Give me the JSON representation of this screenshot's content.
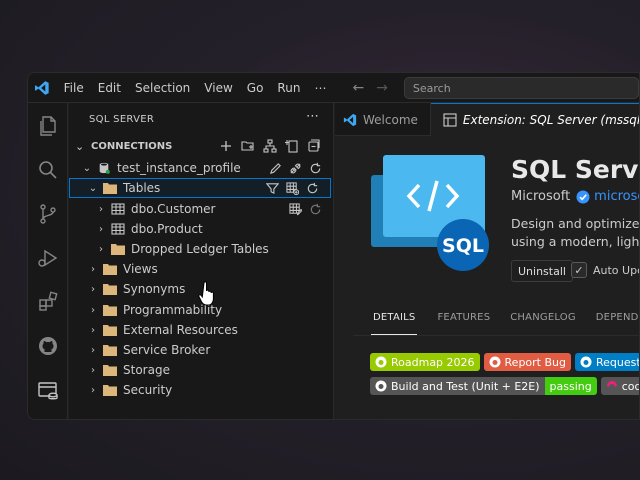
{
  "menu": [
    "File",
    "Edit",
    "Selection",
    "View",
    "Go",
    "Run",
    "⋯"
  ],
  "search": {
    "placeholder": "Search"
  },
  "activity_icons": [
    "explorer-icon",
    "search-icon",
    "source-control-icon",
    "run-debug-icon",
    "extensions-icon",
    "github-icon",
    "sql-server-icon"
  ],
  "sidebar": {
    "title": "SQL SERVER",
    "more": "⋯",
    "section": "CONNECTIONS",
    "tree": [
      {
        "label": "test_instance_profile",
        "icon": "database-icon",
        "twisty": "v",
        "level": 1
      },
      {
        "label": "Tables",
        "icon": "folder-icon",
        "twisty": "v",
        "level": 2,
        "selected": true
      },
      {
        "label": "dbo.Customer",
        "icon": "table-icon",
        "twisty": ">",
        "level": 3
      },
      {
        "label": "dbo.Product",
        "icon": "table-icon",
        "twisty": ">",
        "level": 3
      },
      {
        "label": "Dropped Ledger Tables",
        "icon": "folder-icon",
        "twisty": ">",
        "level": 3
      },
      {
        "label": "Views",
        "icon": "folder-icon",
        "twisty": ">",
        "level": 2
      },
      {
        "label": "Synonyms",
        "icon": "folder-icon",
        "twisty": ">",
        "level": 2
      },
      {
        "label": "Programmability",
        "icon": "folder-icon",
        "twisty": ">",
        "level": 2
      },
      {
        "label": "External Resources",
        "icon": "folder-icon",
        "twisty": ">",
        "level": 2
      },
      {
        "label": "Service Broker",
        "icon": "folder-icon",
        "twisty": ">",
        "level": 2
      },
      {
        "label": "Storage",
        "icon": "folder-icon",
        "twisty": ">",
        "level": 2
      },
      {
        "label": "Security",
        "icon": "folder-icon",
        "twisty": ">",
        "level": 2
      }
    ]
  },
  "tabs": [
    {
      "label": "Welcome",
      "icon": "vscode-icon",
      "active": false
    },
    {
      "label": "Extension: SQL Server (mssql)",
      "icon": "extension-page-icon",
      "active": true
    }
  ],
  "extension": {
    "name": "SQL Server (",
    "publisher": "Microsoft",
    "domain": "microsoft.",
    "desc_line1": "Design and optimize sc",
    "desc_line2": "using a modern, lightw",
    "logo_text": "SQL",
    "uninstall": "Uninstall",
    "auto_update": "Auto Upda",
    "detail_tabs": [
      "DETAILS",
      "FEATURES",
      "CHANGELOG",
      "DEPENDENCIES"
    ],
    "badges_row1": [
      {
        "label": "Roadmap 2026",
        "color": "#97ca00"
      },
      {
        "label": "Report Bug",
        "color": "#e05d44"
      },
      {
        "label": "Request Fea",
        "color": "#007ec6"
      }
    ],
    "build_badge": {
      "left": "Build and Test (Unit + E2E)",
      "right": "passing"
    },
    "codecov_badge": {
      "label": "codeco",
      "color": "#555555"
    }
  },
  "colors": {
    "accent": "#0078d4",
    "folder": "#dcb67a",
    "link": "#3794ff"
  }
}
